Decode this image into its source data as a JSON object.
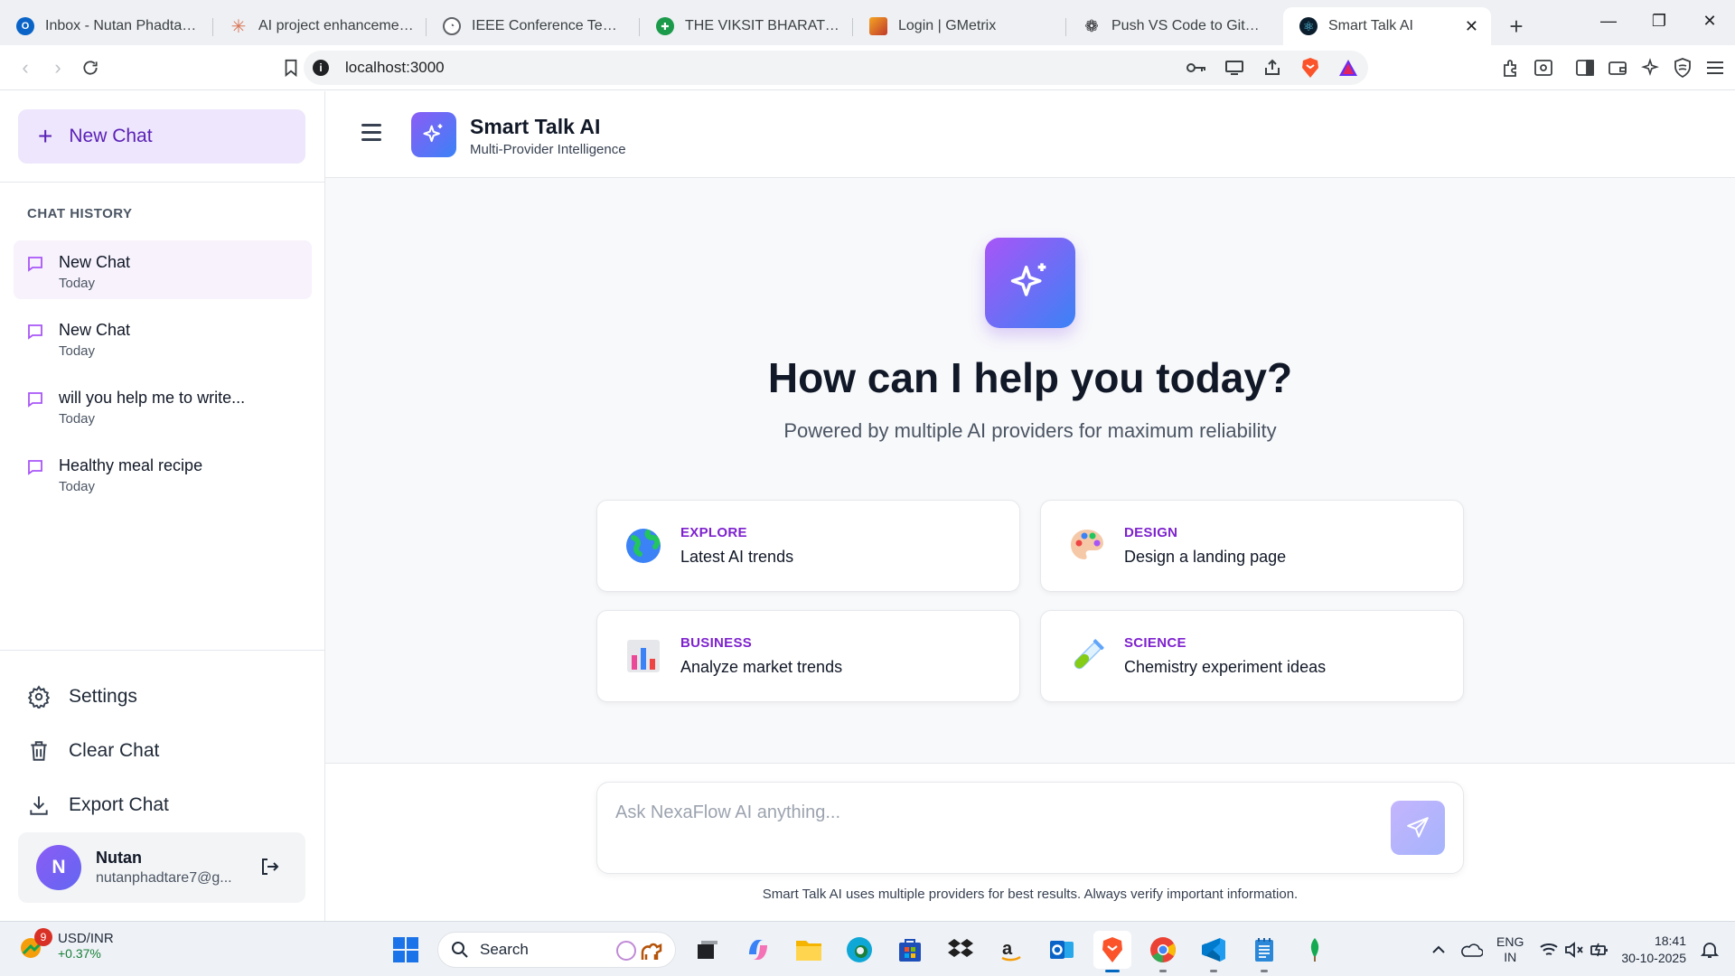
{
  "browser": {
    "tabs": [
      {
        "label": "Inbox - Nutan Phadtare - Outlook",
        "favicon_color": "#0a64c8"
      },
      {
        "label": "AI project enhancement request",
        "favicon_color": "#d97757"
      },
      {
        "label": "IEEE Conference Template",
        "favicon_color": "#5f6368"
      },
      {
        "label": "THE VIKSIT BHARAT QUIZ",
        "favicon_color": "#1a9a4a"
      },
      {
        "label": "Login | GMetrix",
        "favicon_color": "#c0392b"
      },
      {
        "label": "Push VS Code to GitHub",
        "favicon_color": "#202124"
      },
      {
        "label": "Smart Talk AI",
        "favicon_color": "#0b1e2d"
      }
    ],
    "url": "localhost:3000"
  },
  "sidebar": {
    "new_chat_label": "New Chat",
    "history_title": "CHAT HISTORY",
    "history": [
      {
        "title": "New Chat",
        "date": "Today"
      },
      {
        "title": "New Chat",
        "date": "Today"
      },
      {
        "title": "will you help me to write...",
        "date": "Today"
      },
      {
        "title": "Healthy meal recipe",
        "date": "Today"
      }
    ],
    "menu": {
      "settings": "Settings",
      "clear": "Clear Chat",
      "export": "Export Chat"
    },
    "user": {
      "initial": "N",
      "name": "Nutan",
      "email": "nutanphadtare7@g..."
    }
  },
  "header": {
    "title": "Smart Talk AI",
    "subtitle": "Multi-Provider Intelligence"
  },
  "hero": {
    "title": "How can I help you today?",
    "subtitle": "Powered by multiple AI providers for maximum reliability"
  },
  "suggestions": [
    {
      "category": "EXPLORE",
      "text": "Latest AI trends",
      "icon": "globe-icon"
    },
    {
      "category": "DESIGN",
      "text": "Design a landing page",
      "icon": "palette-icon"
    },
    {
      "category": "BUSINESS",
      "text": "Analyze market trends",
      "icon": "bar-chart-icon"
    },
    {
      "category": "SCIENCE",
      "text": "Chemistry experiment ideas",
      "icon": "test-tube-icon"
    }
  ],
  "composer": {
    "placeholder": "Ask NexaFlow AI anything...",
    "disclaimer": "Smart Talk AI uses multiple providers for best results. Always verify important information."
  },
  "taskbar": {
    "ticker_name": "USD/INR",
    "ticker_change": "+0.37%",
    "ticker_badge": "9",
    "search_label": "Search",
    "lang_top": "ENG",
    "lang_bottom": "IN",
    "time": "18:41",
    "date": "30-10-2025"
  },
  "colors": {
    "accent": "#7e22ce",
    "new_chat_bg": "#ede6fc",
    "logo_gradient_start": "#8b5cf6",
    "logo_gradient_end": "#3b82f6"
  }
}
